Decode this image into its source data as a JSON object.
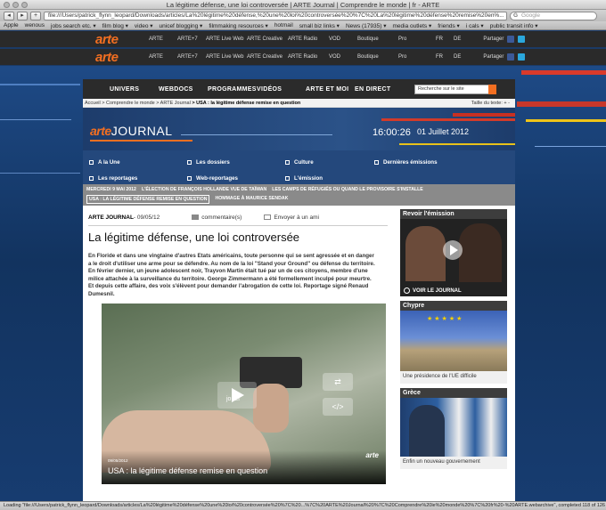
{
  "browser": {
    "window_title": "La légitime défense, une loi controversée | ARTE Journal | Comprendre le monde | fr - ARTE",
    "url": "file:///Users/patrick_flynn_leopard/Downloads/articles/La%20légitime%20défense,%20une%20loi%20controversée%20%7C%20La%20légitime%20défense%20remise%20en%...",
    "search_placeholder": "Google",
    "bookmarks": [
      "Apple",
      "wenous",
      "jobs search etc. ▾",
      "film blog ▾",
      "video ▾",
      "unicef blogging ▾",
      "filmmaking resources ▾",
      "hotmail",
      "small biz links ▾",
      "News (17935) ▾",
      "media outlets ▾",
      "friends ▾",
      "i cals ▾",
      "public transit info ▾"
    ],
    "status": "Loading \"file:///Users/patrick_flynn_leopard/Downloads/articles/La%20légitime%20défense%20une%20loi%20controversée%20%7C%20...%7C%20ARTE%20Journal%20%7C%20Comprendre%20le%20monde%20%7C%20fr%20-%20ARTE.webarchive\", completed 118 of 126 items"
  },
  "arte_top": {
    "logo": "arte",
    "nav": [
      "ARTE",
      "ARTE+7",
      "ARTE Live Web",
      "ARTE Creative",
      "ARTE Radio",
      "VOD",
      "Boutique",
      "Pro"
    ],
    "lang": [
      "FR",
      "DE"
    ],
    "share_label": "Partager"
  },
  "main_nav": {
    "items": [
      "UNIVERS",
      "WEBDOCS",
      "PROGRAMMES",
      "VIDÉOS",
      "ARTE ET MOI",
      "EN DIRECT"
    ],
    "search_placeholder": "Recherche sur le site"
  },
  "breadcrumb": {
    "path": "Accueil > Comprendre le monde > ARTE Journal",
    "current": "> USA : la légitime défense remise en question",
    "text_size": "Taille du texte: + -"
  },
  "hero": {
    "brand_prefix": "arte",
    "brand_suffix": "JOURNAL",
    "clock": "16:00:26",
    "date": "01 Juillet 2012"
  },
  "sub_nav": [
    "A la Une",
    "Les dossiers",
    "Culture",
    "Dernières émissions",
    "Les reportages",
    "Web-reportages",
    "L'émission"
  ],
  "ticker": {
    "row1": [
      "MERCREDI 9 MAI 2012",
      "L'ÉLECTION DE FRANÇOIS HOLLANDE VUE DE TAÏWAN",
      "LES CAMPS DE RÉFUGIÉS OU QUAND LE PROVISOIRE S'INSTALLE"
    ],
    "row2": [
      "USA : LA LÉGITIME DÉFENSE REMISE EN QUESTION",
      "HOMMAGE À MAURICE SENDAK"
    ]
  },
  "article": {
    "source": "ARTE JOURNAL",
    "date": " - 09/05/12",
    "comments": "commentaire(s)",
    "send": "Envoyer à un ami",
    "title": "La légitime défense, une loi controversée",
    "body": "En Floride et dans une vingtaine d'autres Etats américains, toute personne qui se sent agressée et en danger a le droit d'utiliser une arme pour se défendre. Au nom de la loi \"Stand your Ground\" ou défense du territoire. En février dernier, un jeune adolescent noir, Trayvon Martin était tué par un de ces citoyens, membre d'une milice attachée à la surveillance du territoire. George Zimmermann a été formellement inculpé pour meurtre. Et depuis cette affaire, des voix s'élèvent pour demander l'abrogation de cette loi. Reportage signé Renaud Dumesnil."
  },
  "video": {
    "play_label": "jouer",
    "date": "09/05/2012",
    "title": "USA : la légitime défense remise en question",
    "logo": "arte"
  },
  "sidebar": {
    "revoir_title": "Revoir l'émission",
    "revoir_label": "VOIR LE JOURNAL",
    "chypre_title": "Chypre",
    "chypre_desc": "Une présidence de l'UE difficile",
    "grece_title": "Grèce",
    "grece_desc": "Enfin un nouveau gouvernement"
  }
}
